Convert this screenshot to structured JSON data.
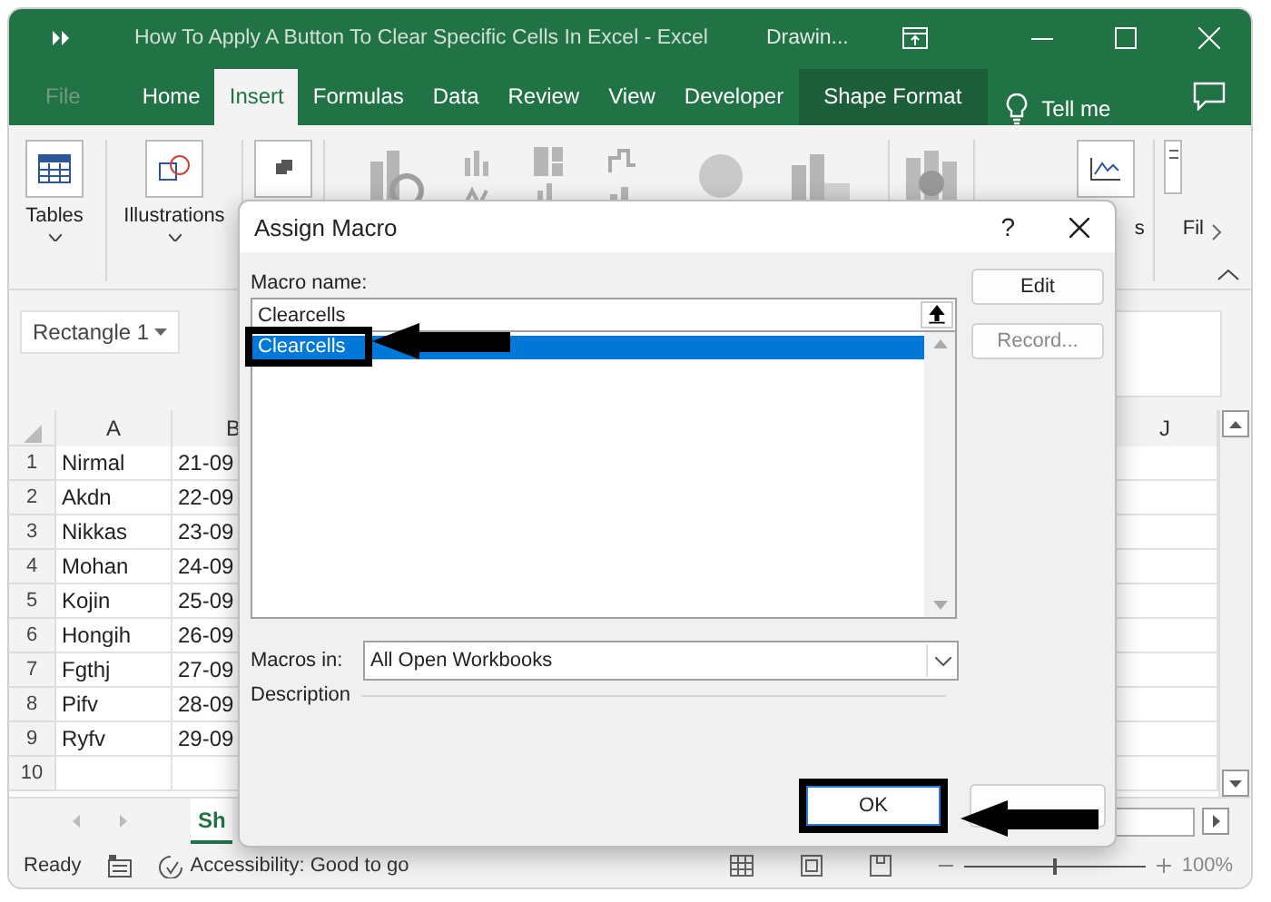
{
  "window": {
    "title": "How To Apply A Button To Clear Specific Cells In Excel  -  Excel",
    "context_label": "Drawin..."
  },
  "ribbon_tabs": [
    {
      "label": "File",
      "selected": false,
      "disabled": true,
      "kind": "plain"
    },
    {
      "label": "Home",
      "selected": false,
      "disabled": false,
      "kind": "plain"
    },
    {
      "label": "Insert",
      "selected": true,
      "disabled": false,
      "kind": "plain"
    },
    {
      "label": "Formulas",
      "selected": false,
      "disabled": false,
      "kind": "plain"
    },
    {
      "label": "Data",
      "selected": false,
      "disabled": false,
      "kind": "plain"
    },
    {
      "label": "Review",
      "selected": false,
      "disabled": false,
      "kind": "plain"
    },
    {
      "label": "View",
      "selected": false,
      "disabled": false,
      "kind": "plain"
    },
    {
      "label": "Developer",
      "selected": false,
      "disabled": false,
      "kind": "plain"
    },
    {
      "label": "Shape Format",
      "selected": false,
      "disabled": false,
      "kind": "contextual"
    }
  ],
  "tell_me": "Tell me",
  "ribbon_groups": [
    {
      "label": "Tables"
    },
    {
      "label": "Illustrations"
    }
  ],
  "ribbon_cut_labels": [
    "s",
    "Fil"
  ],
  "name_box": {
    "value": "Rectangle 1"
  },
  "sheet": {
    "columns": [
      "A",
      "B",
      "J"
    ],
    "rows": [
      {
        "header": "1",
        "cells": [
          "Nirmal",
          "21-09"
        ]
      },
      {
        "header": "2",
        "cells": [
          "Akdn",
          "22-09"
        ]
      },
      {
        "header": "3",
        "cells": [
          "Nikkas",
          "23-09"
        ]
      },
      {
        "header": "4",
        "cells": [
          "Mohan",
          "24-09"
        ]
      },
      {
        "header": "5",
        "cells": [
          "Kojin",
          "25-09"
        ]
      },
      {
        "header": "6",
        "cells": [
          "Hongih",
          "26-09"
        ]
      },
      {
        "header": "7",
        "cells": [
          "Fgthj",
          "27-09"
        ]
      },
      {
        "header": "8",
        "cells": [
          "Pifv",
          "28-09"
        ]
      },
      {
        "header": "9",
        "cells": [
          "Ryfv",
          "29-09"
        ]
      },
      {
        "header": "10",
        "cells": []
      }
    ]
  },
  "sheet_tabs": [
    {
      "label": "Sh",
      "selected": true
    }
  ],
  "status_bar": {
    "ready": "Ready",
    "accessibility": "Accessibility: Good to go",
    "zoom": {
      "level": 0.5,
      "reading": "100%"
    }
  },
  "dialog": {
    "title": "Assign Macro",
    "help": "?",
    "macro_name_label": "Macro name:",
    "macro_name": "Clearcells",
    "macros": [
      {
        "name": "Clearcells",
        "selected": true
      }
    ],
    "buttons": [
      {
        "label": "Edit",
        "disabled": false
      },
      {
        "label": "Record...",
        "disabled": true
      }
    ],
    "macros_in_label": "Macros in:",
    "macros_in": "All Open Workbooks",
    "description_label": "Description",
    "ok": "OK"
  }
}
